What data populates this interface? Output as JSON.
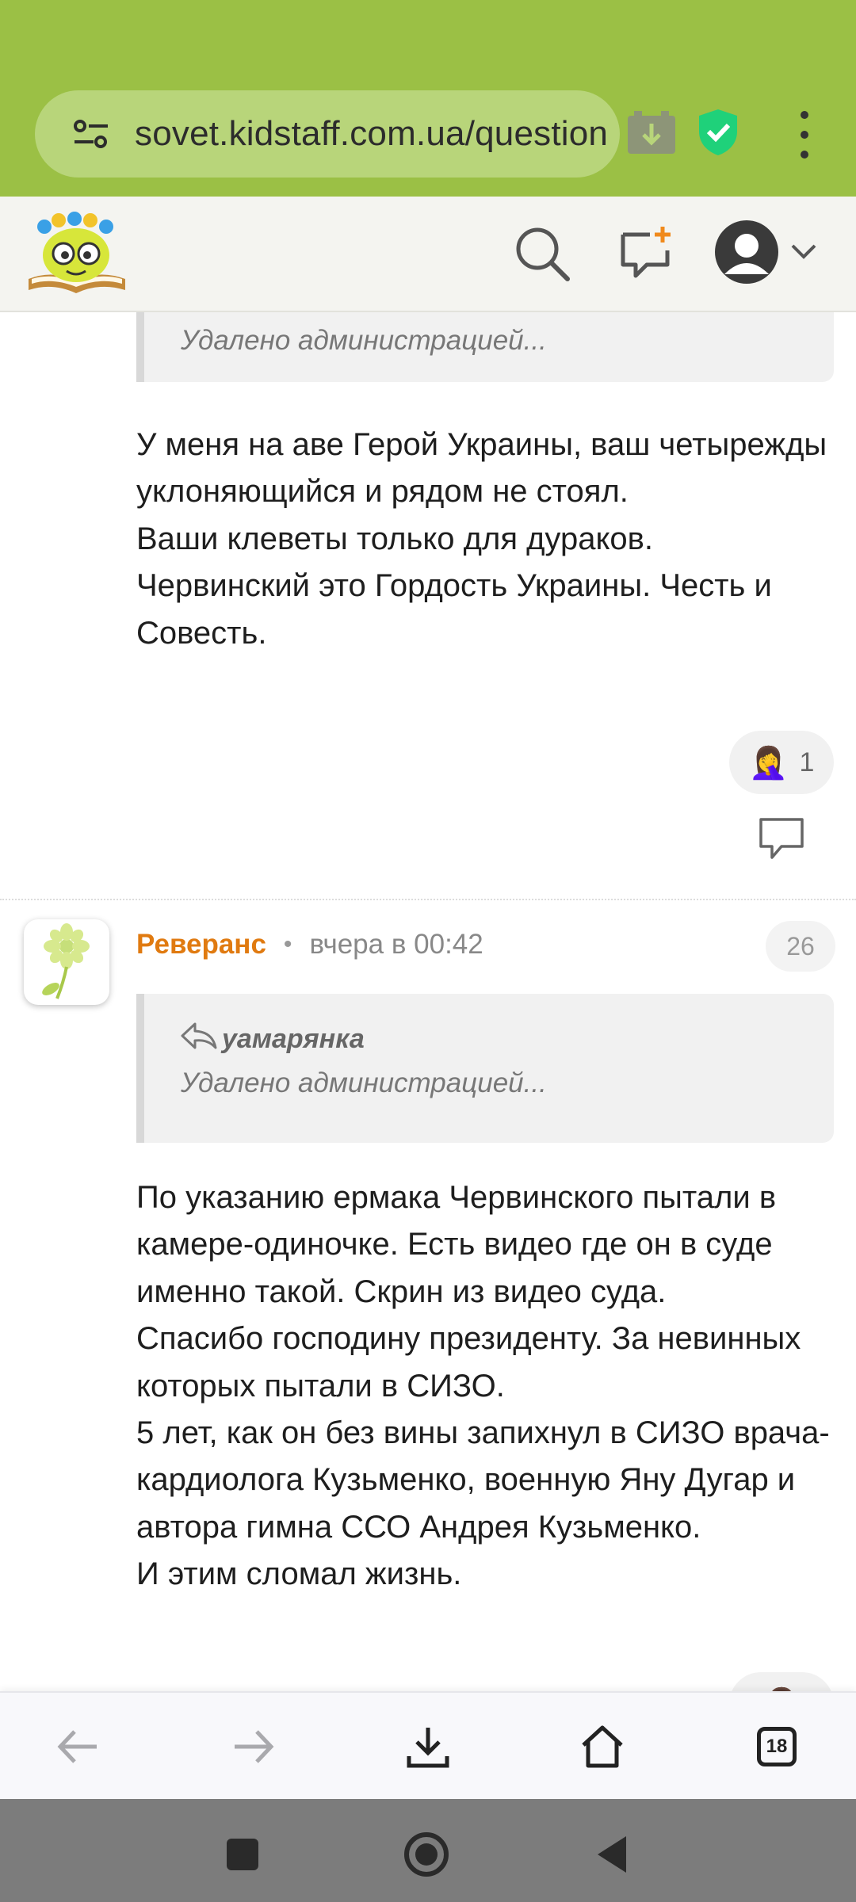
{
  "browser": {
    "url": "sovet.kidstaff.com.ua/question",
    "tab_count": "18",
    "icons": [
      "tune-icon",
      "download-badge-icon",
      "shield-check-icon",
      "more-vert-icon"
    ]
  },
  "site_header": {
    "icons": [
      "site-logo",
      "search-icon",
      "new-message-icon",
      "user-avatar-icon",
      "chevron-down-icon"
    ]
  },
  "post1": {
    "quote_deleted": "Удалено администрацией...",
    "text": "У меня на аве Герой Украины, ваш четырежды уклоняющийся и рядом не стоял.\nВаши клеветы только для дураков.\nЧервинский это Гордость Украины. Честь и Совесть.",
    "reaction_count": "1"
  },
  "post2": {
    "author": "Реверанс",
    "time": "вчера в 00:42",
    "number": "26",
    "quote_author": "уамарянка",
    "quote_deleted": "Удалено администрацией...",
    "text": "По указанию ермака Червинского пытали в камере-одиночке. Есть видео где он в суде именно такой. Скрин из видео суда.\nСпасибо господину президенту. За невинных которых пытали в СИЗО.\n5 лет, как он без вины запихнул в СИЗО врача-кардиолога Кузьменко, военную Яну Дугар и автора гимна ССО Андрея Кузьменко.\nИ этим сломал жизнь."
  },
  "colors": {
    "browser_bar": "#9bc045",
    "url_pill": "#b8d57a",
    "author_name": "#e07a10",
    "shield": "#1fd17a"
  }
}
